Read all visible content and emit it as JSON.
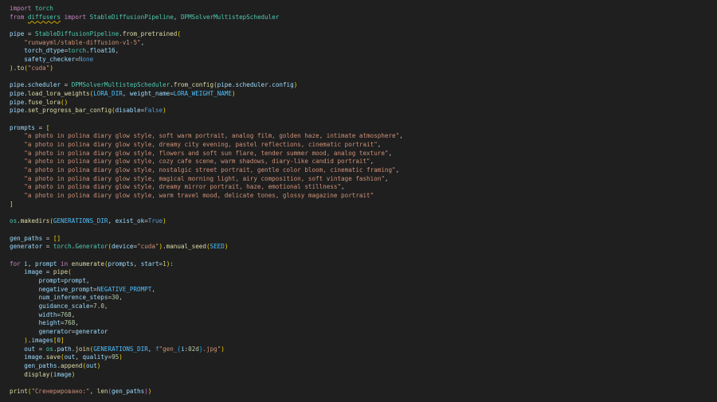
{
  "editor": {
    "language": "python",
    "theme_colors": {
      "background": "#1f1f1f",
      "keyword_flow": "#c586c0",
      "keyword_storage": "#569cd6",
      "variable": "#9cdcfe",
      "function": "#dcdcaa",
      "class": "#4ec9b0",
      "string": "#ce9178",
      "number": "#b5cea8",
      "constant": "#4fc1ff",
      "bracket_1": "#ffd700",
      "bracket_2": "#da70d6",
      "bracket_3": "#179fff",
      "warning_squiggle": "#cca700"
    },
    "lines": [
      [
        [
          "kw-flow",
          "import"
        ],
        [
          "plain",
          " "
        ],
        [
          "cls",
          "torch"
        ]
      ],
      [
        [
          "kw-flow",
          "from"
        ],
        [
          "plain",
          " "
        ],
        [
          "cls squiggle",
          "diffusers"
        ],
        [
          "plain",
          " "
        ],
        [
          "kw-flow",
          "import"
        ],
        [
          "plain",
          " "
        ],
        [
          "cls",
          "StableDiffusionPipeline"
        ],
        [
          "plain",
          ", "
        ],
        [
          "cls",
          "DPMSolverMultistepScheduler"
        ]
      ],
      [],
      [
        [
          "var",
          "pipe"
        ],
        [
          "plain",
          " = "
        ],
        [
          "cls",
          "StableDiffusionPipeline"
        ],
        [
          "plain",
          "."
        ],
        [
          "fn",
          "from_pretrained"
        ],
        [
          "b1",
          "("
        ]
      ],
      [
        [
          "plain",
          "    "
        ],
        [
          "str",
          "\"runwayml/stable-diffusion-v1-5\""
        ],
        [
          "plain",
          ","
        ]
      ],
      [
        [
          "plain",
          "    "
        ],
        [
          "var",
          "torch_dtype"
        ],
        [
          "plain",
          "="
        ],
        [
          "cls",
          "torch"
        ],
        [
          "plain",
          "."
        ],
        [
          "var",
          "float16"
        ],
        [
          "plain",
          ","
        ]
      ],
      [
        [
          "plain",
          "    "
        ],
        [
          "var",
          "safety_checker"
        ],
        [
          "plain",
          "="
        ],
        [
          "kw-stor",
          "None"
        ]
      ],
      [
        [
          "b1",
          ")"
        ],
        [
          "plain",
          "."
        ],
        [
          "fn",
          "to"
        ],
        [
          "b1",
          "("
        ],
        [
          "str",
          "\"cuda\""
        ],
        [
          "b1",
          ")"
        ]
      ],
      [],
      [
        [
          "var",
          "pipe"
        ],
        [
          "plain",
          "."
        ],
        [
          "var",
          "scheduler"
        ],
        [
          "plain",
          " = "
        ],
        [
          "cls",
          "DPMSolverMultistepScheduler"
        ],
        [
          "plain",
          "."
        ],
        [
          "fn",
          "from_config"
        ],
        [
          "b1",
          "("
        ],
        [
          "var",
          "pipe"
        ],
        [
          "plain",
          "."
        ],
        [
          "var",
          "scheduler"
        ],
        [
          "plain",
          "."
        ],
        [
          "var",
          "config"
        ],
        [
          "b1",
          ")"
        ]
      ],
      [
        [
          "var",
          "pipe"
        ],
        [
          "plain",
          "."
        ],
        [
          "fn",
          "load_lora_weights"
        ],
        [
          "b1",
          "("
        ],
        [
          "const",
          "LORA_DIR"
        ],
        [
          "plain",
          ", "
        ],
        [
          "var",
          "weight_name"
        ],
        [
          "plain",
          "="
        ],
        [
          "const",
          "LORA_WEIGHT_NAME"
        ],
        [
          "b1",
          ")"
        ]
      ],
      [
        [
          "var",
          "pipe"
        ],
        [
          "plain",
          "."
        ],
        [
          "fn",
          "fuse_lora"
        ],
        [
          "b1",
          "()"
        ]
      ],
      [
        [
          "var",
          "pipe"
        ],
        [
          "plain",
          "."
        ],
        [
          "fn",
          "set_progress_bar_config"
        ],
        [
          "b1",
          "("
        ],
        [
          "var",
          "disable"
        ],
        [
          "plain",
          "="
        ],
        [
          "kw-stor",
          "False"
        ],
        [
          "b1",
          ")"
        ]
      ],
      [],
      [
        [
          "var",
          "prompts"
        ],
        [
          "plain",
          " = "
        ],
        [
          "b1",
          "["
        ]
      ],
      [
        [
          "plain",
          "    "
        ],
        [
          "str",
          "\"a photo in polina diary glow style, soft warm portrait, analog film, golden haze, intimate atmosphere\""
        ],
        [
          "plain",
          ","
        ]
      ],
      [
        [
          "plain",
          "    "
        ],
        [
          "str",
          "\"a photo in polina diary glow style, dreamy city evening, pastel reflections, cinematic portrait\""
        ],
        [
          "plain",
          ","
        ]
      ],
      [
        [
          "plain",
          "    "
        ],
        [
          "str",
          "\"a photo in polina diary glow style, flowers and soft sun flare, tender summer mood, analog texture\""
        ],
        [
          "plain",
          ","
        ]
      ],
      [
        [
          "plain",
          "    "
        ],
        [
          "str",
          "\"a photo in polina diary glow style, cozy cafe scene, warm shadows, diary-like candid portrait\""
        ],
        [
          "plain",
          ","
        ]
      ],
      [
        [
          "plain",
          "    "
        ],
        [
          "str",
          "\"a photo in polina diary glow style, nostalgic street portrait, gentle color bloom, cinematic framing\""
        ],
        [
          "plain",
          ","
        ]
      ],
      [
        [
          "plain",
          "    "
        ],
        [
          "str",
          "\"a photo in polina diary glow style, magical morning light, airy composition, soft vintage fashion\""
        ],
        [
          "plain",
          ","
        ]
      ],
      [
        [
          "plain",
          "    "
        ],
        [
          "str",
          "\"a photo in polina diary glow style, dreamy mirror portrait, haze, emotional stillness\""
        ],
        [
          "plain",
          ","
        ]
      ],
      [
        [
          "plain",
          "    "
        ],
        [
          "str",
          "\"a photo in polina diary glow style, warm travel mood, delicate tones, glossy magazine portrait\""
        ]
      ],
      [
        [
          "b1",
          "]"
        ]
      ],
      [],
      [
        [
          "cls",
          "os"
        ],
        [
          "plain",
          "."
        ],
        [
          "fn",
          "makedirs"
        ],
        [
          "b1",
          "("
        ],
        [
          "const",
          "GENERATIONS_DIR"
        ],
        [
          "plain",
          ", "
        ],
        [
          "var",
          "exist_ok"
        ],
        [
          "plain",
          "="
        ],
        [
          "kw-stor",
          "True"
        ],
        [
          "b1",
          ")"
        ]
      ],
      [],
      [
        [
          "var",
          "gen_paths"
        ],
        [
          "plain",
          " = "
        ],
        [
          "b1",
          "[]"
        ]
      ],
      [
        [
          "var",
          "generator"
        ],
        [
          "plain",
          " = "
        ],
        [
          "cls",
          "torch"
        ],
        [
          "plain",
          "."
        ],
        [
          "cls",
          "Generator"
        ],
        [
          "b1",
          "("
        ],
        [
          "var",
          "device"
        ],
        [
          "plain",
          "="
        ],
        [
          "str",
          "\"cuda\""
        ],
        [
          "b1",
          ")"
        ],
        [
          "plain",
          "."
        ],
        [
          "fn",
          "manual_seed"
        ],
        [
          "b1",
          "("
        ],
        [
          "const",
          "SEED"
        ],
        [
          "b1",
          ")"
        ]
      ],
      [],
      [
        [
          "kw-flow",
          "for"
        ],
        [
          "plain",
          " "
        ],
        [
          "var",
          "i"
        ],
        [
          "plain",
          ", "
        ],
        [
          "var",
          "prompt"
        ],
        [
          "plain",
          " "
        ],
        [
          "kw-flow",
          "in"
        ],
        [
          "plain",
          " "
        ],
        [
          "fn",
          "enumerate"
        ],
        [
          "b1",
          "("
        ],
        [
          "var",
          "prompts"
        ],
        [
          "plain",
          ", "
        ],
        [
          "var",
          "start"
        ],
        [
          "plain",
          "="
        ],
        [
          "num",
          "1"
        ],
        [
          "b1",
          ")"
        ],
        [
          "plain",
          ":"
        ]
      ],
      [
        [
          "plain",
          "    "
        ],
        [
          "var",
          "image"
        ],
        [
          "plain",
          " = "
        ],
        [
          "fn",
          "pipe"
        ],
        [
          "b1",
          "("
        ]
      ],
      [
        [
          "plain",
          "        "
        ],
        [
          "var",
          "prompt"
        ],
        [
          "plain",
          "="
        ],
        [
          "var",
          "prompt"
        ],
        [
          "plain",
          ","
        ]
      ],
      [
        [
          "plain",
          "        "
        ],
        [
          "var",
          "negative_prompt"
        ],
        [
          "plain",
          "="
        ],
        [
          "const",
          "NEGATIVE_PROMPT"
        ],
        [
          "plain",
          ","
        ]
      ],
      [
        [
          "plain",
          "        "
        ],
        [
          "var",
          "num_inference_steps"
        ],
        [
          "plain",
          "="
        ],
        [
          "num",
          "30"
        ],
        [
          "plain",
          ","
        ]
      ],
      [
        [
          "plain",
          "        "
        ],
        [
          "var",
          "guidance_scale"
        ],
        [
          "plain",
          "="
        ],
        [
          "num",
          "7.0"
        ],
        [
          "plain",
          ","
        ]
      ],
      [
        [
          "plain",
          "        "
        ],
        [
          "var",
          "width"
        ],
        [
          "plain",
          "="
        ],
        [
          "num",
          "768"
        ],
        [
          "plain",
          ","
        ]
      ],
      [
        [
          "plain",
          "        "
        ],
        [
          "var",
          "height"
        ],
        [
          "plain",
          "="
        ],
        [
          "num",
          "768"
        ],
        [
          "plain",
          ","
        ]
      ],
      [
        [
          "plain",
          "        "
        ],
        [
          "var",
          "generator"
        ],
        [
          "plain",
          "="
        ],
        [
          "var",
          "generator"
        ]
      ],
      [
        [
          "plain",
          "    "
        ],
        [
          "b1",
          ")"
        ],
        [
          "plain",
          "."
        ],
        [
          "var",
          "images"
        ],
        [
          "b1",
          "["
        ],
        [
          "num",
          "0"
        ],
        [
          "b1",
          "]"
        ]
      ],
      [
        [
          "plain",
          "    "
        ],
        [
          "var",
          "out"
        ],
        [
          "plain",
          " = "
        ],
        [
          "cls",
          "os"
        ],
        [
          "plain",
          "."
        ],
        [
          "var",
          "path"
        ],
        [
          "plain",
          "."
        ],
        [
          "fn",
          "join"
        ],
        [
          "b1",
          "("
        ],
        [
          "const",
          "GENERATIONS_DIR"
        ],
        [
          "plain",
          ", "
        ],
        [
          "kw-stor",
          "f"
        ],
        [
          "str",
          "\"gen_"
        ],
        [
          "b3",
          "{"
        ],
        [
          "var",
          "i"
        ],
        [
          "plain",
          ":"
        ],
        [
          "num",
          "02d"
        ],
        [
          "b3",
          "}"
        ],
        [
          "str",
          ".jpg\""
        ],
        [
          "b1",
          ")"
        ]
      ],
      [
        [
          "plain",
          "    "
        ],
        [
          "var",
          "image"
        ],
        [
          "plain",
          "."
        ],
        [
          "fn",
          "save"
        ],
        [
          "b1",
          "("
        ],
        [
          "var",
          "out"
        ],
        [
          "plain",
          ", "
        ],
        [
          "var",
          "quality"
        ],
        [
          "plain",
          "="
        ],
        [
          "num",
          "95"
        ],
        [
          "b1",
          ")"
        ]
      ],
      [
        [
          "plain",
          "    "
        ],
        [
          "var",
          "gen_paths"
        ],
        [
          "plain",
          "."
        ],
        [
          "fn",
          "append"
        ],
        [
          "b1",
          "("
        ],
        [
          "var",
          "out"
        ],
        [
          "b1",
          ")"
        ]
      ],
      [
        [
          "plain",
          "    "
        ],
        [
          "fn",
          "display"
        ],
        [
          "b1",
          "("
        ],
        [
          "var",
          "image"
        ],
        [
          "b1",
          ")"
        ]
      ],
      [],
      [
        [
          "fn",
          "print"
        ],
        [
          "b1",
          "("
        ],
        [
          "str",
          "\"Сгенерировано:\""
        ],
        [
          "plain",
          ", "
        ],
        [
          "fn",
          "len"
        ],
        [
          "b2",
          "("
        ],
        [
          "var",
          "gen_paths"
        ],
        [
          "b2",
          ")"
        ],
        [
          "b1",
          ")"
        ]
      ]
    ]
  }
}
